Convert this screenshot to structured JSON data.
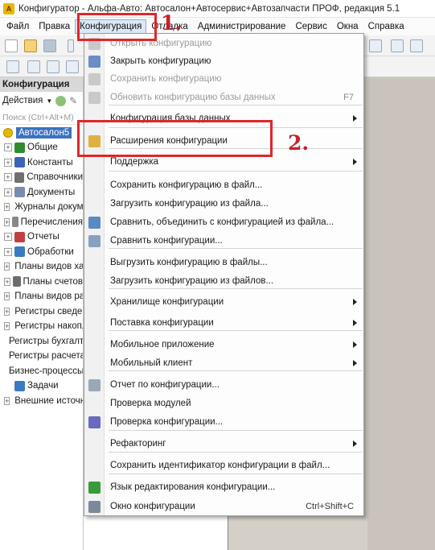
{
  "window": {
    "title": "Конфигуратор - Альфа-Авто: Автосалон+Автосервис+Автозапчасти ПРОФ, редакция 5.1"
  },
  "menubar": {
    "items": [
      "Файл",
      "Правка",
      "Конфигурация",
      "Отладка",
      "Администрирование",
      "Сервис",
      "Окна",
      "Справка"
    ],
    "active": "Конфигурация"
  },
  "sidebar": {
    "title": "Конфигурация",
    "actions_label": "Действия",
    "search_placeholder": "Поиск (Ctrl+Alt+M)",
    "root": "Автосалон5",
    "items": [
      {
        "label": "Общие",
        "icon": "common-icon",
        "color": "#2e8b2e",
        "expandable": true
      },
      {
        "label": "Константы",
        "icon": "constants-icon",
        "color": "#3b63b8",
        "expandable": true
      },
      {
        "label": "Справочники",
        "icon": "catalogs-icon",
        "color": "#6f6f6f",
        "expandable": true
      },
      {
        "label": "Документы",
        "icon": "documents-icon",
        "color": "#7a8bb0",
        "expandable": true
      },
      {
        "label": "Журналы документов",
        "icon": "journals-icon",
        "color": "#2e8b2e",
        "expandable": true
      },
      {
        "label": "Перечисления",
        "icon": "enums-icon",
        "color": "#888888",
        "expandable": true
      },
      {
        "label": "Отчеты",
        "icon": "reports-icon",
        "color": "#c04040",
        "expandable": true
      },
      {
        "label": "Обработки",
        "icon": "processing-icon",
        "color": "#3a7ac0",
        "expandable": true
      },
      {
        "label": "Планы видов характеристик",
        "icon": "chart-char-icon",
        "color": "#6c6c6c",
        "expandable": true
      },
      {
        "label": "Планы счетов",
        "icon": "chart-accounts-icon",
        "color": "#6c6c6c",
        "expandable": true
      },
      {
        "label": "Планы видов расчета",
        "icon": "chart-calc-icon",
        "color": "#3a9a3a",
        "expandable": true
      },
      {
        "label": "Регистры сведений",
        "icon": "info-registers-icon",
        "color": "#6a6a6a",
        "expandable": true
      },
      {
        "label": "Регистры накопления",
        "icon": "accum-registers-icon",
        "color": "#3a7ac0",
        "expandable": true
      },
      {
        "label": "Регистры бухгалтерии",
        "icon": "acc-registers-icon",
        "color": "#6a6a6a",
        "expandable": false
      },
      {
        "label": "Регистры расчета",
        "icon": "calc-registers-icon",
        "color": "#3a7ac0",
        "expandable": false
      },
      {
        "label": "Бизнес-процессы",
        "icon": "business-process-icon",
        "color": "#4a4a4a",
        "expandable": false
      },
      {
        "label": "Задачи",
        "icon": "tasks-icon",
        "color": "#3a7ac0",
        "expandable": false
      },
      {
        "label": "Внешние источники данных",
        "icon": "external-sources-icon",
        "color": "#3a7ac0",
        "expandable": true
      }
    ]
  },
  "dropdown": {
    "items": [
      {
        "label": "Открыть конфигурацию",
        "disabled": true,
        "icon": "open-config-icon"
      },
      {
        "label": "Закрыть конфигурацию",
        "disabled": false,
        "icon": "close-config-icon"
      },
      {
        "label": "Сохранить конфигурацию",
        "disabled": true,
        "icon": "save-config-icon"
      },
      {
        "label": "Обновить конфигурацию базы данных",
        "disabled": true,
        "icon": "update-db-icon",
        "shortcut": "F7"
      },
      {
        "label": "Конфигурация базы данных",
        "disabled": false,
        "submenu": true
      },
      {
        "label": "Расширения конфигурации",
        "disabled": false,
        "icon": "extensions-icon"
      },
      {
        "label": "Поддержка",
        "disabled": false,
        "submenu": true
      },
      {
        "label": "Сохранить конфигурацию в файл...",
        "disabled": false
      },
      {
        "label": "Загрузить конфигурацию из файла...",
        "disabled": false
      },
      {
        "label": "Сравнить, объединить с конфигурацией из файла...",
        "disabled": false,
        "icon": "compare-merge-icon"
      },
      {
        "label": "Сравнить конфигурации...",
        "disabled": false,
        "icon": "compare-icon"
      },
      {
        "label": "Выгрузить конфигурацию в файлы...",
        "disabled": false
      },
      {
        "label": "Загрузить конфигурацию из файлов...",
        "disabled": false
      },
      {
        "label": "Хранилище конфигурации",
        "disabled": false,
        "submenu": true
      },
      {
        "label": "Поставка конфигурации",
        "disabled": false,
        "submenu": true
      },
      {
        "label": "Мобильное приложение",
        "disabled": false,
        "submenu": true
      },
      {
        "label": "Мобильный клиент",
        "disabled": false,
        "submenu": true
      },
      {
        "label": "Отчет по конфигурации...",
        "disabled": false,
        "icon": "report-icon"
      },
      {
        "label": "Проверка модулей",
        "disabled": false
      },
      {
        "label": "Проверка конфигурации...",
        "disabled": false,
        "icon": "check-icon"
      },
      {
        "label": "Рефакторинг",
        "disabled": false,
        "submenu": true
      },
      {
        "label": "Сохранить идентификатор конфигурации в файл...",
        "disabled": false
      },
      {
        "label": "Язык редактирования конфигурации...",
        "disabled": false,
        "icon": "language-icon"
      },
      {
        "label": "Окно конфигурации",
        "disabled": false,
        "icon": "window-icon",
        "shortcut": "Ctrl+Shift+C"
      }
    ]
  },
  "annotations": {
    "step1": "1.",
    "step2": "2."
  },
  "colors": {
    "annotation": "#e0262a",
    "selection": "#3b72c0"
  }
}
